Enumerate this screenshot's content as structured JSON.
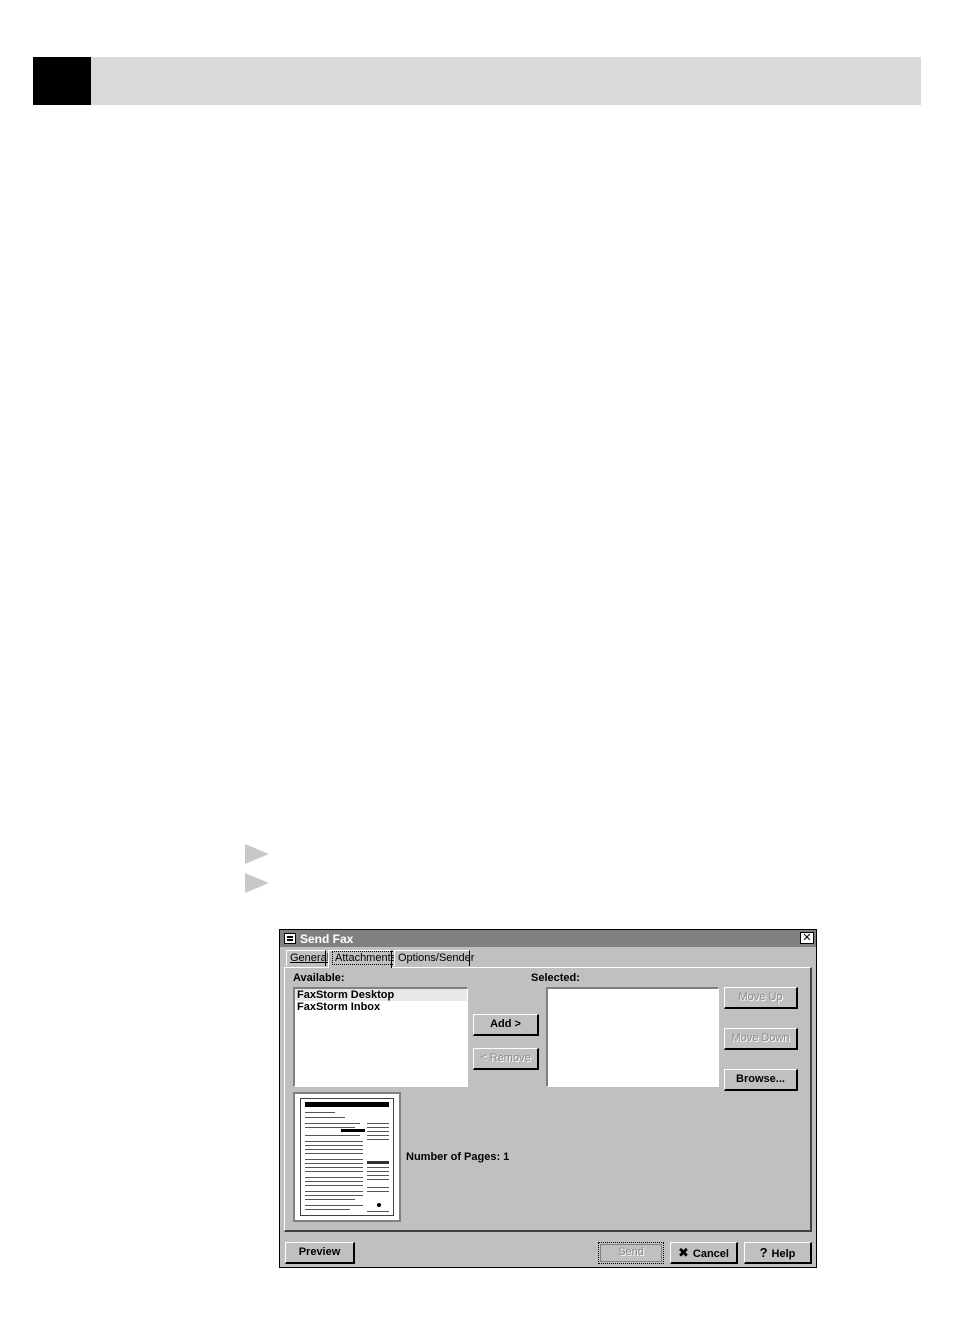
{
  "dialog": {
    "title": "Send Fax",
    "close": "✕",
    "tabs": [
      "General",
      "Attachments",
      "Options/Sender"
    ],
    "available_label": "Available:",
    "selected_label": "Selected:",
    "available_items": [
      "FaxStorm Desktop",
      "FaxStorm Inbox"
    ],
    "buttons": {
      "add": "Add >",
      "remove": "< Remove",
      "move_up": "Move Up",
      "move_down": "Move Down",
      "browse": "Browse...",
      "preview": "Preview",
      "send": "Send",
      "cancel": "Cancel",
      "help": "Help"
    },
    "pages_label": "Number of Pages:  1"
  },
  "icons": {
    "cancel": "x-icon",
    "help": "question-icon",
    "step": "arrow-right-icon"
  }
}
